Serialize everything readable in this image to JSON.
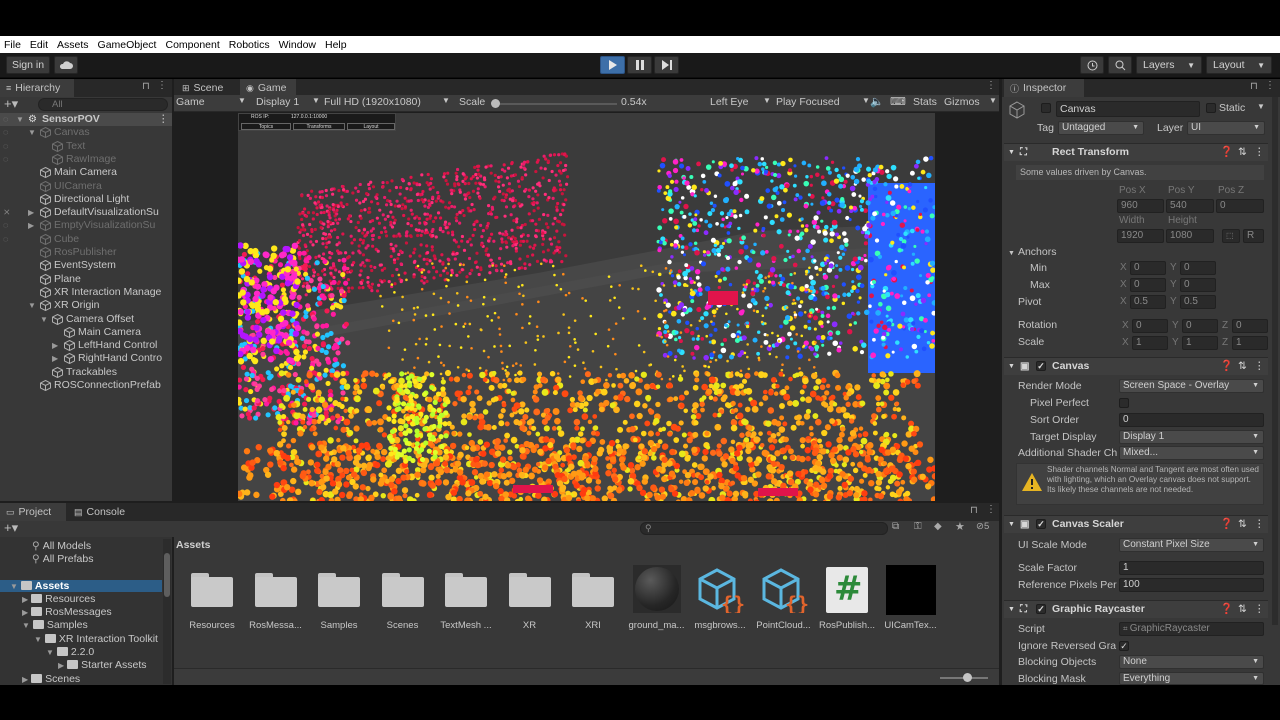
{
  "menu": [
    "File",
    "Edit",
    "Assets",
    "GameObject",
    "Component",
    "Robotics",
    "Window",
    "Help"
  ],
  "toolbar": {
    "signin": "Sign in",
    "layers": "Layers",
    "layout": "Layout"
  },
  "hierarchy": {
    "tab": "Hierarchy",
    "search_placeholder": "All",
    "items": [
      {
        "label": "SensorPOV",
        "indent": 0,
        "dim": false,
        "bold": true
      },
      {
        "label": "Canvas",
        "indent": 1,
        "dim": true
      },
      {
        "label": "Text",
        "indent": 2,
        "dim": true
      },
      {
        "label": "RawImage",
        "indent": 2,
        "dim": true
      },
      {
        "label": "Main Camera",
        "indent": 1,
        "dim": false
      },
      {
        "label": "UICamera",
        "indent": 1,
        "dim": true
      },
      {
        "label": "Directional Light",
        "indent": 1,
        "dim": false
      },
      {
        "label": "DefaultVisualizationSu",
        "indent": 1,
        "dim": false
      },
      {
        "label": "EmptyVisualizationSu",
        "indent": 1,
        "dim": true
      },
      {
        "label": "Cube",
        "indent": 1,
        "dim": true
      },
      {
        "label": "RosPublisher",
        "indent": 1,
        "dim": true
      },
      {
        "label": "EventSystem",
        "indent": 1,
        "dim": false
      },
      {
        "label": "Plane",
        "indent": 1,
        "dim": false
      },
      {
        "label": "XR Interaction Manage",
        "indent": 1,
        "dim": false
      },
      {
        "label": "XR Origin",
        "indent": 1,
        "dim": false
      },
      {
        "label": "Camera Offset",
        "indent": 2,
        "dim": false
      },
      {
        "label": "Main Camera",
        "indent": 3,
        "dim": false
      },
      {
        "label": "LeftHand Control",
        "indent": 3,
        "dim": false
      },
      {
        "label": "RightHand Contro",
        "indent": 3,
        "dim": false
      },
      {
        "label": "Trackables",
        "indent": 2,
        "dim": false
      },
      {
        "label": "ROSConnectionPrefab",
        "indent": 1,
        "dim": false
      }
    ]
  },
  "game": {
    "tabs": [
      "Scene",
      "Game"
    ],
    "mode": "Game",
    "display": "Display 1",
    "resolution": "Full HD (1920x1080)",
    "scale_label": "Scale",
    "scale_value": "0.54x",
    "eye": "Left Eye",
    "focus": "Play Focused",
    "stats": "Stats",
    "gizmos": "Gizmos",
    "hud": {
      "ros_ip_label": "ROS IP:",
      "ros_ip": "127.0.0.1:10000",
      "buttons": [
        "Topics",
        "Transforms",
        "Layout"
      ]
    }
  },
  "inspector": {
    "tab": "Inspector",
    "object_name": "Canvas",
    "static": "Static",
    "tag_label": "Tag",
    "tag": "Untagged",
    "layer_label": "Layer",
    "layer": "UI",
    "rect": {
      "title": "Rect Transform",
      "note": "Some values driven by Canvas.",
      "posx_l": "Pos X",
      "posy_l": "Pos Y",
      "posz_l": "Pos Z",
      "posx": "960",
      "posy": "540",
      "posz": "0",
      "width_l": "Width",
      "height_l": "Height",
      "width": "1920",
      "height": "1080",
      "anchors": "Anchors",
      "min": "Min",
      "max": "Max",
      "pivot": "Pivot",
      "rotation": "Rotation",
      "scale": "Scale",
      "min_x": "0",
      "min_y": "0",
      "max_x": "0",
      "max_y": "0",
      "pivot_x": "0.5",
      "pivot_y": "0.5",
      "rot_x": "0",
      "rot_y": "0",
      "rot_z": "0",
      "sc_x": "1",
      "sc_y": "1",
      "sc_z": "1",
      "r_btn": "R"
    },
    "canvas": {
      "title": "Canvas",
      "render_mode_l": "Render Mode",
      "render_mode": "Screen Space - Overlay",
      "pixel_perfect": "Pixel Perfect",
      "sort_order_l": "Sort Order",
      "sort_order": "0",
      "target_display_l": "Target Display",
      "target_display": "Display 1",
      "shader_l": "Additional Shader Ch",
      "shader": "Mixed...",
      "warning": "Shader channels Normal and Tangent are most often used with lighting, which an Overlay canvas does not support. Its likely these channels are not needed."
    },
    "scaler": {
      "title": "Canvas Scaler",
      "mode_l": "UI Scale Mode",
      "mode": "Constant Pixel Size",
      "factor_l": "Scale Factor",
      "factor": "1",
      "ref_l": "Reference Pixels Per",
      "ref": "100"
    },
    "raycaster": {
      "title": "Graphic Raycaster",
      "script_l": "Script",
      "script": "GraphicRaycaster",
      "ignore_l": "Ignore Reversed Gra",
      "blocking_l": "Blocking Objects",
      "blocking": "None",
      "mask_l": "Blocking Mask",
      "mask": "Everything"
    }
  },
  "project": {
    "tabs": [
      "Project",
      "Console"
    ],
    "hidden_count": "5",
    "tree": [
      {
        "label": "All Models",
        "indent": 1,
        "kind": "search"
      },
      {
        "label": "All Prefabs",
        "indent": 1,
        "kind": "search"
      },
      {
        "label": "Assets",
        "indent": 0,
        "kind": "folder"
      },
      {
        "label": "Resources",
        "indent": 1,
        "kind": "folder"
      },
      {
        "label": "RosMessages",
        "indent": 1,
        "kind": "folder"
      },
      {
        "label": "Samples",
        "indent": 1,
        "kind": "folder"
      },
      {
        "label": "XR Interaction Toolkit",
        "indent": 2,
        "kind": "folder"
      },
      {
        "label": "2.2.0",
        "indent": 3,
        "kind": "folder"
      },
      {
        "label": "Starter Assets",
        "indent": 4,
        "kind": "folder"
      },
      {
        "label": "Scenes",
        "indent": 1,
        "kind": "folder"
      }
    ],
    "breadcrumb": "Assets",
    "assets": [
      {
        "label": "Resources",
        "kind": "folder"
      },
      {
        "label": "RosMessa...",
        "kind": "folder"
      },
      {
        "label": "Samples",
        "kind": "folder"
      },
      {
        "label": "Scenes",
        "kind": "folder"
      },
      {
        "label": "TextMesh ...",
        "kind": "folder"
      },
      {
        "label": "XR",
        "kind": "folder"
      },
      {
        "label": "XRI",
        "kind": "folder"
      },
      {
        "label": "ground_ma...",
        "kind": "material"
      },
      {
        "label": "msgbrows...",
        "kind": "script-cube"
      },
      {
        "label": "PointCloud...",
        "kind": "script-cube"
      },
      {
        "label": "RosPublish...",
        "kind": "csharp"
      },
      {
        "label": "UICamTex...",
        "kind": "texture"
      }
    ]
  }
}
